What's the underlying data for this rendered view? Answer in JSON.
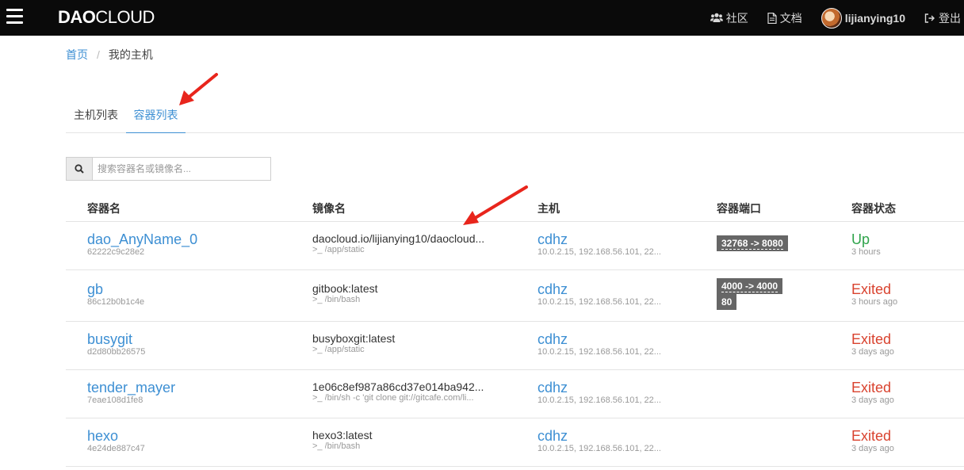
{
  "header": {
    "logo_bold": "DAO",
    "logo_rest": "CLOUD",
    "community_label": "社区",
    "docs_label": "文档",
    "username": "lijianying10",
    "logout_label": "登出",
    "icons": [
      "menu-icon",
      "users-icon",
      "document-icon",
      "avatar",
      "logout-icon"
    ]
  },
  "breadcrumb": {
    "home": "首页",
    "separator": "/",
    "current": "我的主机"
  },
  "tabs": [
    {
      "label": "主机列表",
      "active": false
    },
    {
      "label": "容器列表",
      "active": true
    }
  ],
  "search": {
    "placeholder": "搜索容器名或镜像名..."
  },
  "table": {
    "columns": [
      "容器名",
      "镜像名",
      "主机",
      "容器端口",
      "容器状态"
    ],
    "rows": [
      {
        "name": "dao_AnyName_0",
        "id": "62222c9c28e2",
        "image": "daocloud.io/lijianying10/daocloud...",
        "prompt": ">_",
        "command": "/app/static",
        "host": "cdhz",
        "host_ips": "10.0.2.15, 192.168.56.101, 22...",
        "ports": [
          "32768 -> 8080"
        ],
        "status": "Up",
        "status_time": "3 hours"
      },
      {
        "name": "gb",
        "id": "86c12b0b1c4e",
        "image": "gitbook:latest",
        "prompt": ">_",
        "command": "/bin/bash",
        "host": "cdhz",
        "host_ips": "10.0.2.15, 192.168.56.101, 22...",
        "ports": [
          "4000 -> 4000",
          "80"
        ],
        "status": "Exited",
        "status_time": "3 hours ago"
      },
      {
        "name": "busygit",
        "id": "d2d80bb26575",
        "image": "busyboxgit:latest",
        "prompt": ">_",
        "command": "/app/static",
        "host": "cdhz",
        "host_ips": "10.0.2.15, 192.168.56.101, 22...",
        "ports": [],
        "status": "Exited",
        "status_time": "3 days ago"
      },
      {
        "name": "tender_mayer",
        "id": "7eae108d1fe8",
        "image": "1e06c8ef987a86cd37e014ba942...",
        "prompt": ">_",
        "command": "/bin/sh -c 'git clone git://gitcafe.com/li...",
        "host": "cdhz",
        "host_ips": "10.0.2.15, 192.168.56.101, 22...",
        "ports": [],
        "status": "Exited",
        "status_time": "3 days ago"
      },
      {
        "name": "hexo",
        "id": "4e24de887c47",
        "image": "hexo3:latest",
        "prompt": ">_",
        "command": "/bin/bash",
        "host": "cdhz",
        "host_ips": "10.0.2.15, 192.168.56.101, 22...",
        "ports": [],
        "status": "Exited",
        "status_time": "3 days ago"
      }
    ]
  },
  "colors": {
    "accent": "#3d8fd3",
    "status_up": "#2ea34a",
    "status_exited": "#d9432f",
    "annotation_arrow": "#e8251c",
    "navbar": "#0a0a0a"
  }
}
